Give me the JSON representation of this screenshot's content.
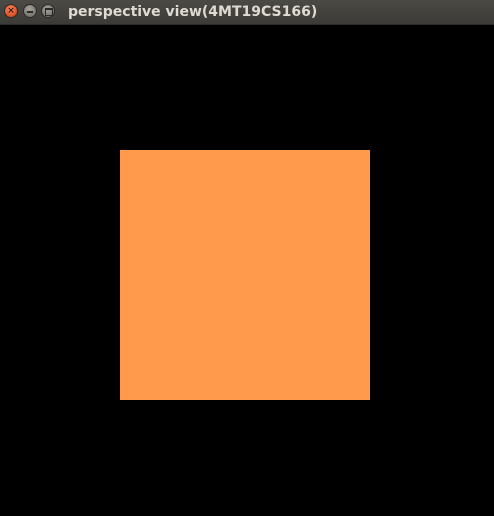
{
  "window": {
    "title": "perspective view(4MT19CS166)",
    "close_icon": "close-icon",
    "minimize_icon": "minimize-icon",
    "maximize_icon": "maximize-icon",
    "close_glyph": "×"
  },
  "scene": {
    "background_color": "#000000",
    "square_color": "#FF994C"
  }
}
